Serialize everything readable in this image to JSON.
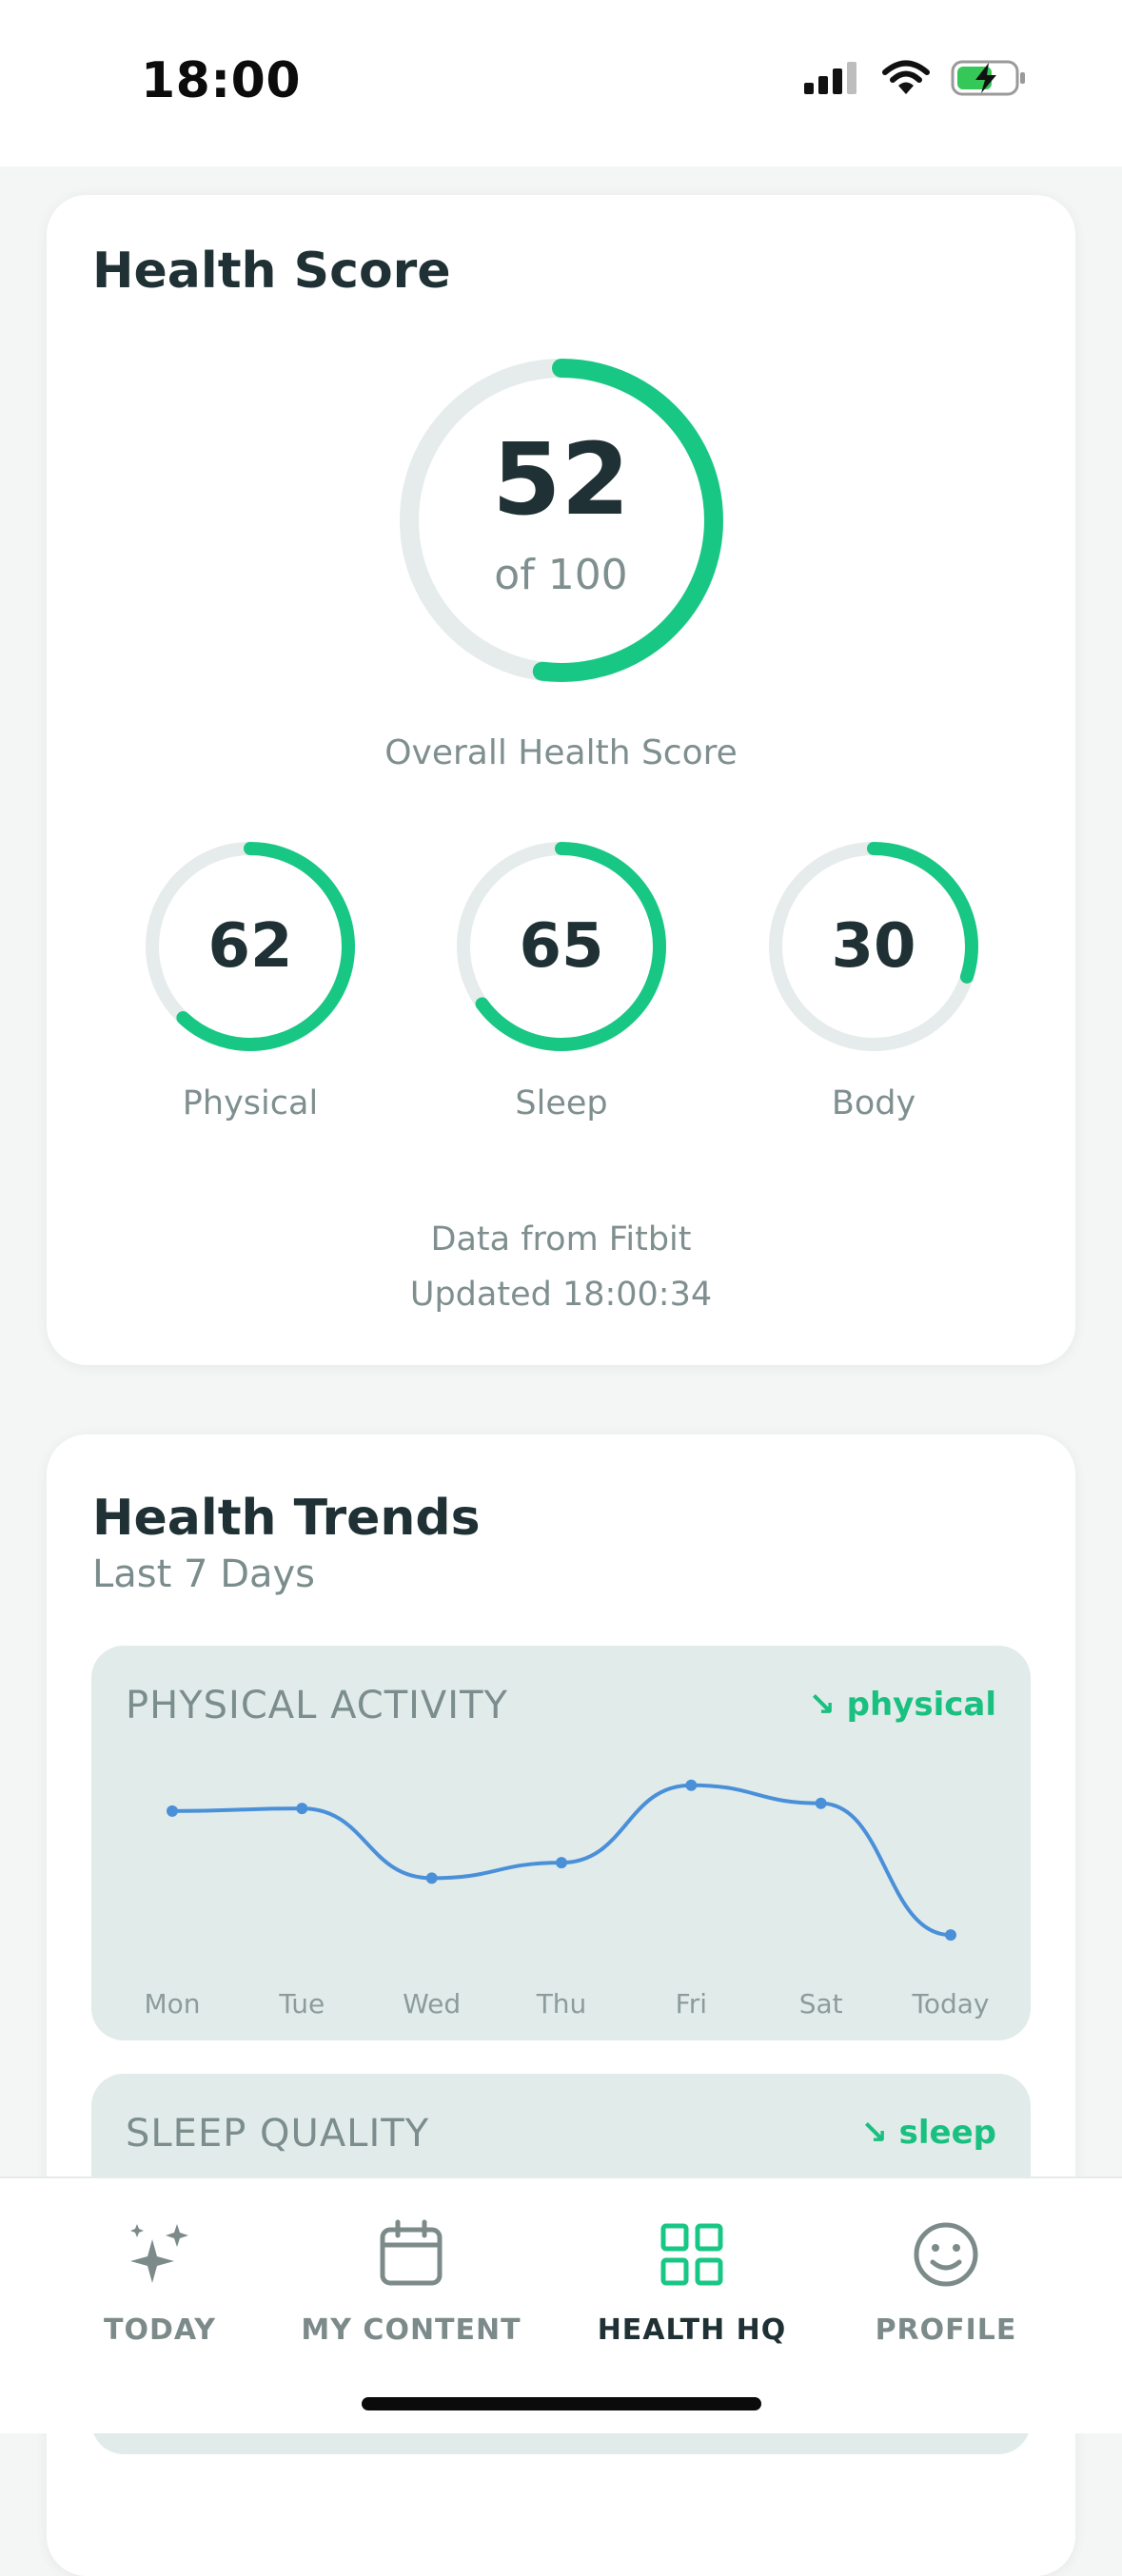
{
  "status": {
    "time": "18:00"
  },
  "health_score": {
    "title": "Health Score",
    "overall": {
      "value": "52",
      "of_text": "of 100",
      "label": "Overall Health Score",
      "fraction": 0.52
    },
    "subscores": [
      {
        "value": "62",
        "label": "Physical",
        "fraction": 0.62
      },
      {
        "value": "65",
        "label": "Sleep",
        "fraction": 0.65
      },
      {
        "value": "30",
        "label": "Body",
        "fraction": 0.3
      }
    ],
    "source": "Data from Fitbit",
    "updated": "Updated 18:00:34"
  },
  "trends": {
    "title": "Health Trends",
    "subtitle": "Last 7 Days",
    "physical": {
      "title": "PHYSICAL ACTIVITY",
      "tag": "↘ physical",
      "days": [
        "Mon",
        "Tue",
        "Wed",
        "Thu",
        "Fri",
        "Sat",
        "Today"
      ],
      "values": [
        66,
        66.5,
        53,
        56,
        71,
        67.5,
        42
      ]
    },
    "sleep": {
      "title": "SLEEP QUALITY",
      "tag": "↘ sleep"
    }
  },
  "nav": {
    "items": [
      {
        "label": "TODAY",
        "icon": "sparkles-icon"
      },
      {
        "label": "MY CONTENT",
        "icon": "calendar-icon"
      },
      {
        "label": "HEALTH HQ",
        "icon": "grid-icon"
      },
      {
        "label": "PROFILE",
        "icon": "smiley-icon"
      }
    ],
    "active": 2
  },
  "colors": {
    "accent": "#19c785",
    "track": "#e5eceb",
    "line": "#4a90d9"
  }
}
